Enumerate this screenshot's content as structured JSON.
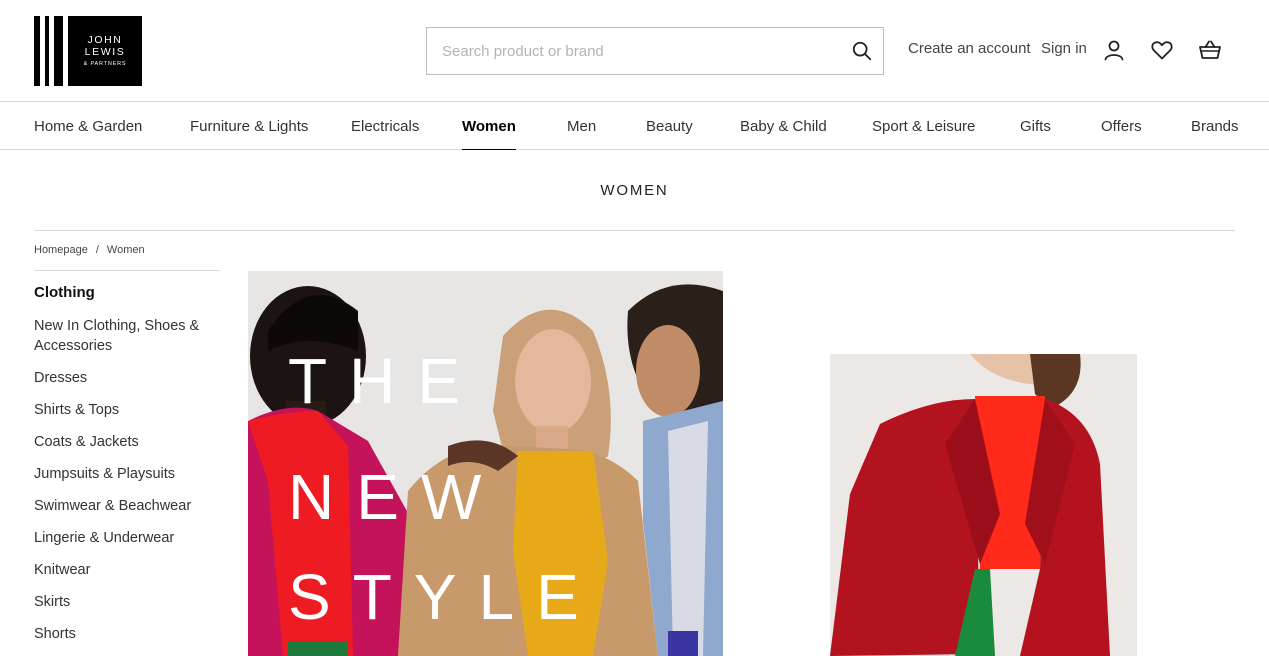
{
  "brand": {
    "logo_line1": "JOHN",
    "logo_line2": "LEWIS",
    "logo_line3": "& PARTNERS"
  },
  "search": {
    "placeholder": "Search product or brand"
  },
  "header": {
    "create_account": "Create an account",
    "sign_in": "Sign in"
  },
  "nav": {
    "items": [
      {
        "label": "Home & Garden"
      },
      {
        "label": "Furniture & Lights"
      },
      {
        "label": "Electricals"
      },
      {
        "label": "Women"
      },
      {
        "label": "Men"
      },
      {
        "label": "Beauty"
      },
      {
        "label": "Baby & Child"
      },
      {
        "label": "Sport & Leisure"
      },
      {
        "label": "Gifts"
      },
      {
        "label": "Offers"
      },
      {
        "label": "Brands"
      }
    ],
    "active": "Women"
  },
  "page": {
    "title": "WOMEN"
  },
  "breadcrumb": {
    "items": [
      "Homepage",
      "/",
      "Women"
    ]
  },
  "side_menu": {
    "heading": "Clothing",
    "items": [
      "New In Clothing, Shoes & Accessories",
      "Dresses",
      "Shirts & Tops",
      "Coats & Jackets",
      "Jumpsuits & Playsuits",
      "Swimwear & Beachwear",
      "Lingerie & Underwear",
      "Knitwear",
      "Skirts",
      "Shorts"
    ]
  },
  "hero": {
    "line1": "THE",
    "line2": "NEW",
    "line3": "STYLE"
  },
  "icons": {
    "search": "search-icon",
    "account": "account-icon",
    "wishlist": "heart-icon",
    "basket": "basket-icon"
  }
}
